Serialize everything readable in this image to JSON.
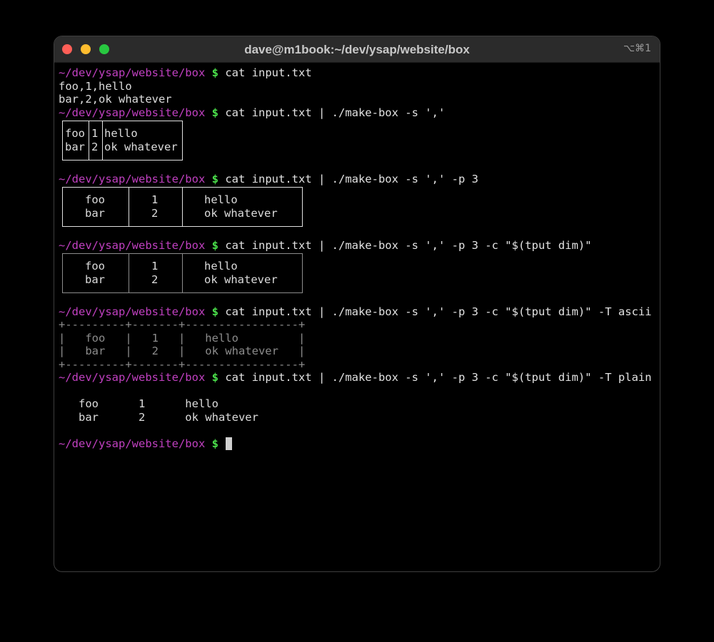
{
  "window": {
    "title": "dave@m1book:~/dev/ysap/website/box",
    "shortcut": "⌥⌘1"
  },
  "prompt": {
    "path": "~/dev/ysap/website/box",
    "symbol": "$"
  },
  "commands": [
    "cat input.txt",
    "cat input.txt | ./make-box -s ','",
    "cat input.txt | ./make-box -s ',' -p 3",
    "cat input.txt | ./make-box -s ',' -p 3 -c \"$(tput dim)\"",
    "cat input.txt | ./make-box -s ',' -p 3 -c \"$(tput dim)\" -T ascii",
    "cat input.txt | ./make-box -s ',' -p 3 -c \"$(tput dim)\" -T plain"
  ],
  "input_lines": [
    "foo,1,hello",
    "bar,2,ok whatever"
  ],
  "cells": {
    "r1": [
      "foo",
      "1",
      "hello"
    ],
    "r2": [
      "bar",
      "2",
      "ok whatever"
    ]
  },
  "ascii_table": {
    "border": "+---------+-------+-----------------+",
    "row1": "|   foo   |   1   |   hello         |",
    "row2": "|   bar   |   2   |   ok whatever   |"
  },
  "plain_table": {
    "row1": "   foo      1      hello",
    "row2": "   bar      2      ok whatever"
  }
}
